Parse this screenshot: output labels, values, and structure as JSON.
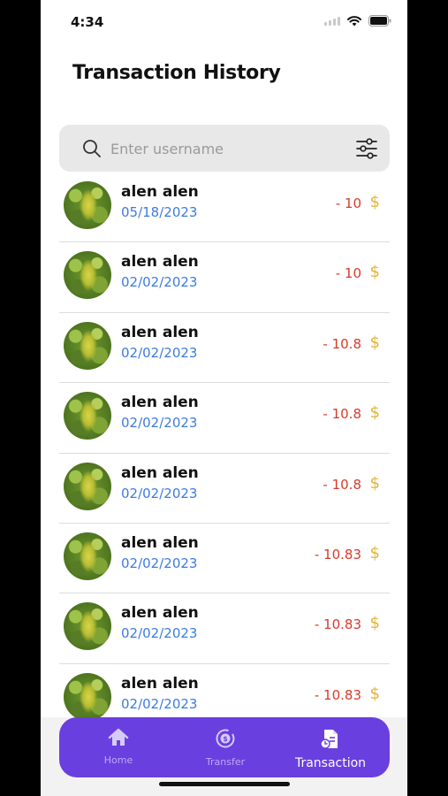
{
  "status_bar": {
    "time": "4:34"
  },
  "page_title": "Transaction History",
  "search": {
    "placeholder": "Enter username",
    "value": ""
  },
  "transactions": [
    {
      "name": "alen alen",
      "date": "05/18/2023",
      "amount": "- 10",
      "currency": "$"
    },
    {
      "name": "alen alen",
      "date": "02/02/2023",
      "amount": "- 10",
      "currency": "$"
    },
    {
      "name": "alen alen",
      "date": "02/02/2023",
      "amount": "- 10.8",
      "currency": "$"
    },
    {
      "name": "alen alen",
      "date": "02/02/2023",
      "amount": "- 10.8",
      "currency": "$"
    },
    {
      "name": "alen alen",
      "date": "02/02/2023",
      "amount": "- 10.8",
      "currency": "$"
    },
    {
      "name": "alen alen",
      "date": "02/02/2023",
      "amount": "- 10.83",
      "currency": "$"
    },
    {
      "name": "alen alen",
      "date": "02/02/2023",
      "amount": "- 10.83",
      "currency": "$"
    },
    {
      "name": "alen alen",
      "date": "02/02/2023",
      "amount": "- 10.83",
      "currency": "$"
    }
  ],
  "tabbar": {
    "home_label": "Home",
    "transfer_label": "Transfer",
    "transaction_label": "Transaction",
    "active": "Transaction"
  },
  "colors": {
    "accent": "#6a3fe0",
    "date": "#3d7be0",
    "amount_negative": "#d83a2b",
    "currency": "#e0b43a"
  },
  "icons": [
    "search-icon",
    "filter-icon",
    "home-icon",
    "transfer-icon",
    "transaction-icon",
    "wifi-icon",
    "battery-icon",
    "signal-icon"
  ]
}
